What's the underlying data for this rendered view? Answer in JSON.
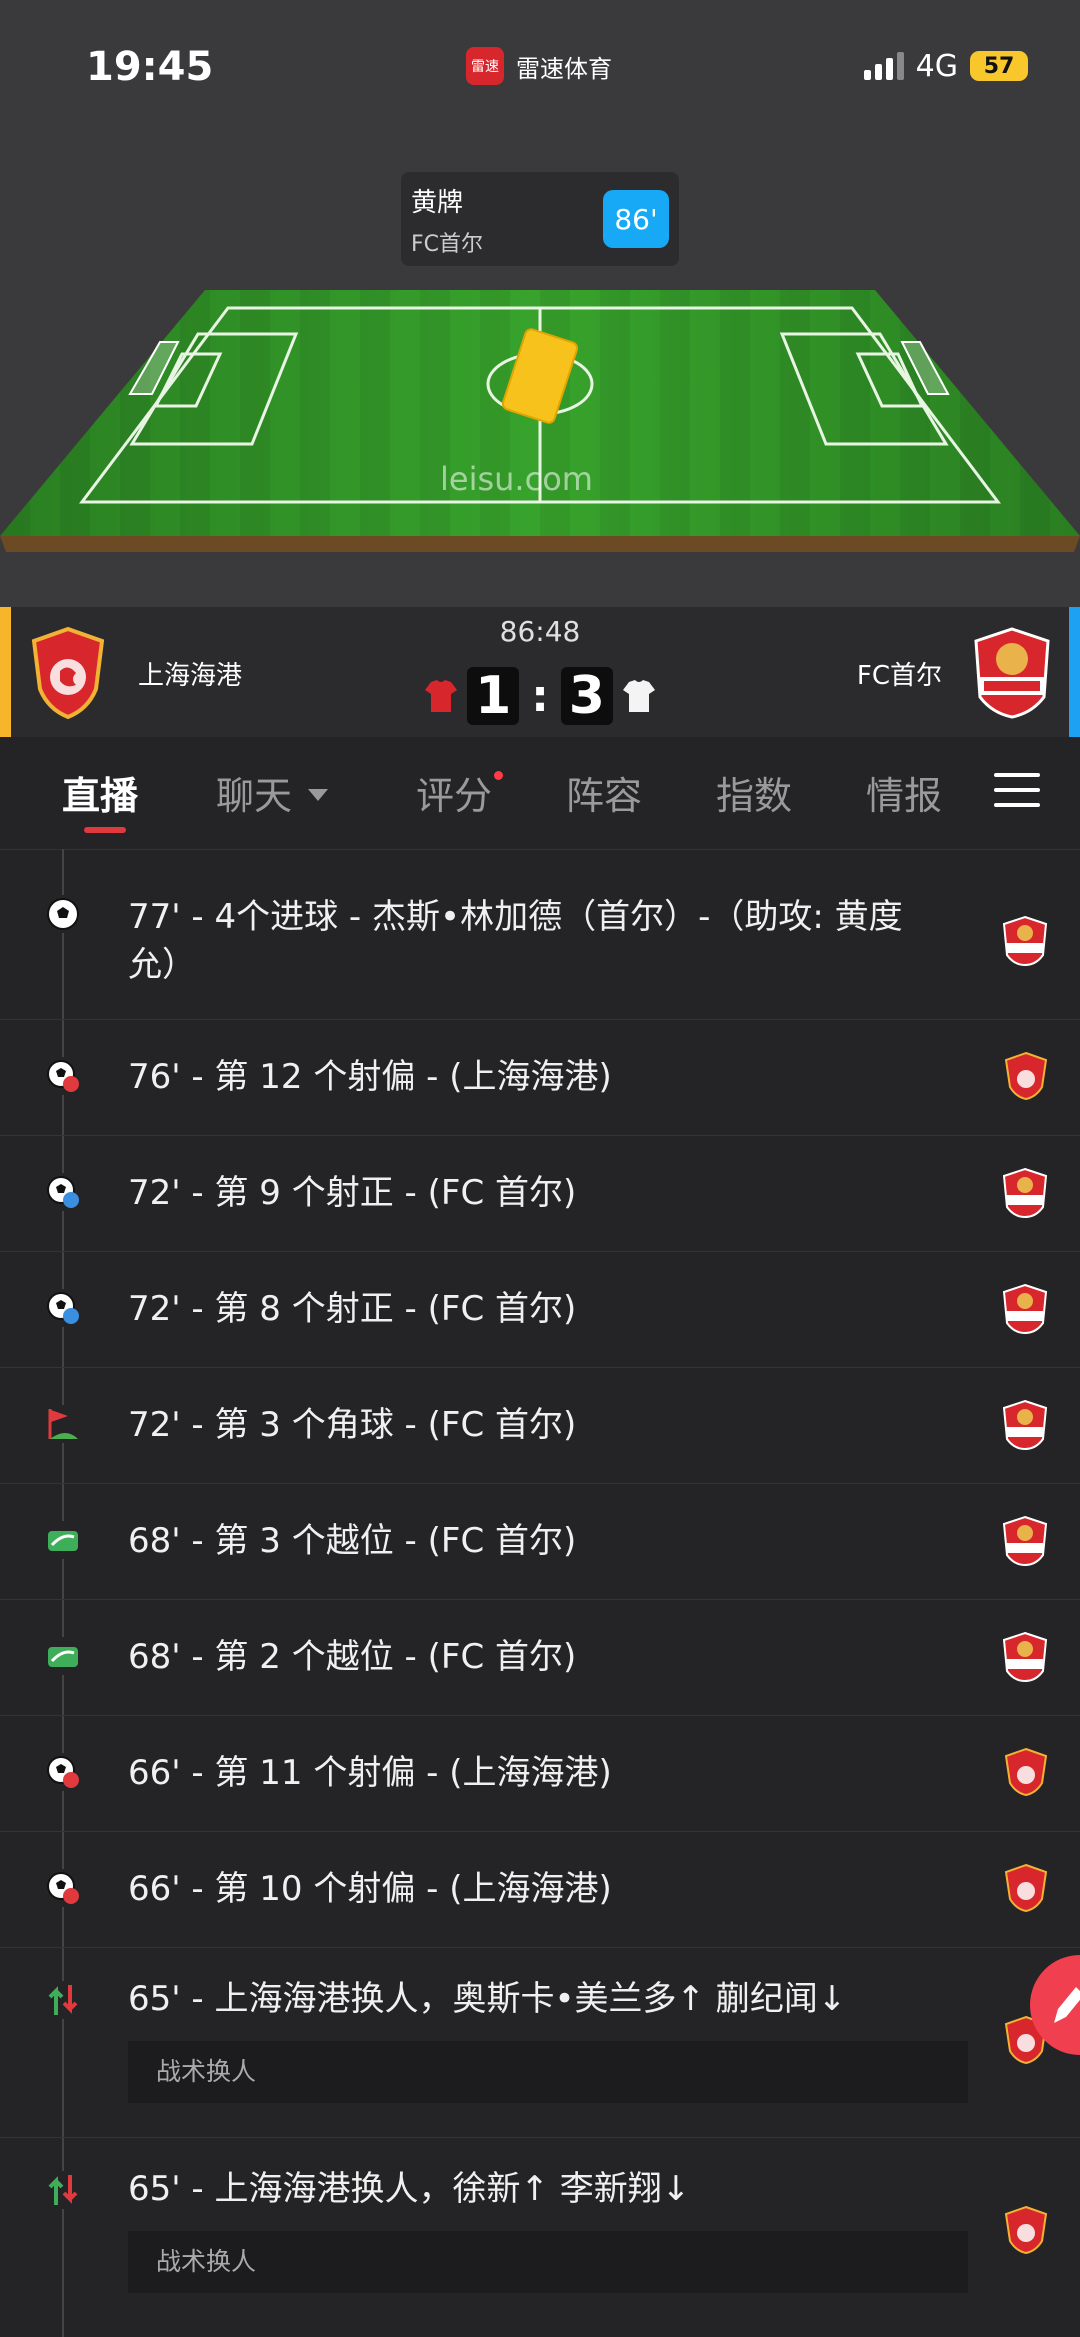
{
  "status_bar": {
    "time": "19:45",
    "app_logo_text": "雷速",
    "app_name": "雷速体育",
    "network": "4G",
    "battery": "57"
  },
  "pitch": {
    "event": {
      "title": "黄牌",
      "team": "FC首尔",
      "minute": "86'"
    },
    "watermark": "leisu.com"
  },
  "match": {
    "clock": "86:48",
    "home": {
      "name": "上海海港",
      "score": "1",
      "color": "#d8272c"
    },
    "away": {
      "name": "FC首尔",
      "score": "3",
      "color": "#ffffff"
    },
    "colon": ":"
  },
  "tabs": [
    {
      "label": "直播",
      "active": true
    },
    {
      "label": "聊天"
    },
    {
      "label": "评分"
    },
    {
      "label": "阵容"
    },
    {
      "label": "指数"
    },
    {
      "label": "情报"
    }
  ],
  "events": [
    {
      "icon": "goal-icon",
      "text": "77' - 4个进球 - 杰斯•林加德（首尔）-（助攻: 黄度允）",
      "team": "away"
    },
    {
      "icon": "shot-off-target-icon",
      "text": "76' - 第 12 个射偏 - (上海海港)",
      "team": "home"
    },
    {
      "icon": "shot-on-target-icon",
      "text": "72' - 第 9 个射正 - (FC 首尔)",
      "team": "away"
    },
    {
      "icon": "shot-on-target-icon",
      "text": "72' - 第 8 个射正 - (FC 首尔)",
      "team": "away"
    },
    {
      "icon": "corner-flag-icon",
      "text": "72' - 第 3 个角球 - (FC 首尔)",
      "team": "away"
    },
    {
      "icon": "offside-icon",
      "text": "68' - 第 3 个越位 - (FC 首尔)",
      "team": "away"
    },
    {
      "icon": "offside-icon",
      "text": "68' - 第 2 个越位 - (FC 首尔)",
      "team": "away"
    },
    {
      "icon": "shot-off-target-icon",
      "text": "66' - 第 11 个射偏 - (上海海港)",
      "team": "home"
    },
    {
      "icon": "shot-off-target-icon",
      "text": "66' - 第 10 个射偏 - (上海海港)",
      "team": "home"
    },
    {
      "icon": "substitution-icon",
      "text": "65' - 上海海港换人，奥斯卡•美兰多↑ 蒯纪闻↓",
      "note": "战术换人",
      "team": "home"
    },
    {
      "icon": "substitution-icon",
      "text": "65' - 上海海港换人，徐新↑ 李新翔↓",
      "note": "战术换人",
      "team": "home"
    }
  ],
  "colors": {
    "accent_red": "#e03a3f",
    "accent_blue": "#17a9f5",
    "home_bar": "#f7b52c",
    "away_bar": "#1da1f2",
    "pitch_green": "#2e8a24"
  }
}
